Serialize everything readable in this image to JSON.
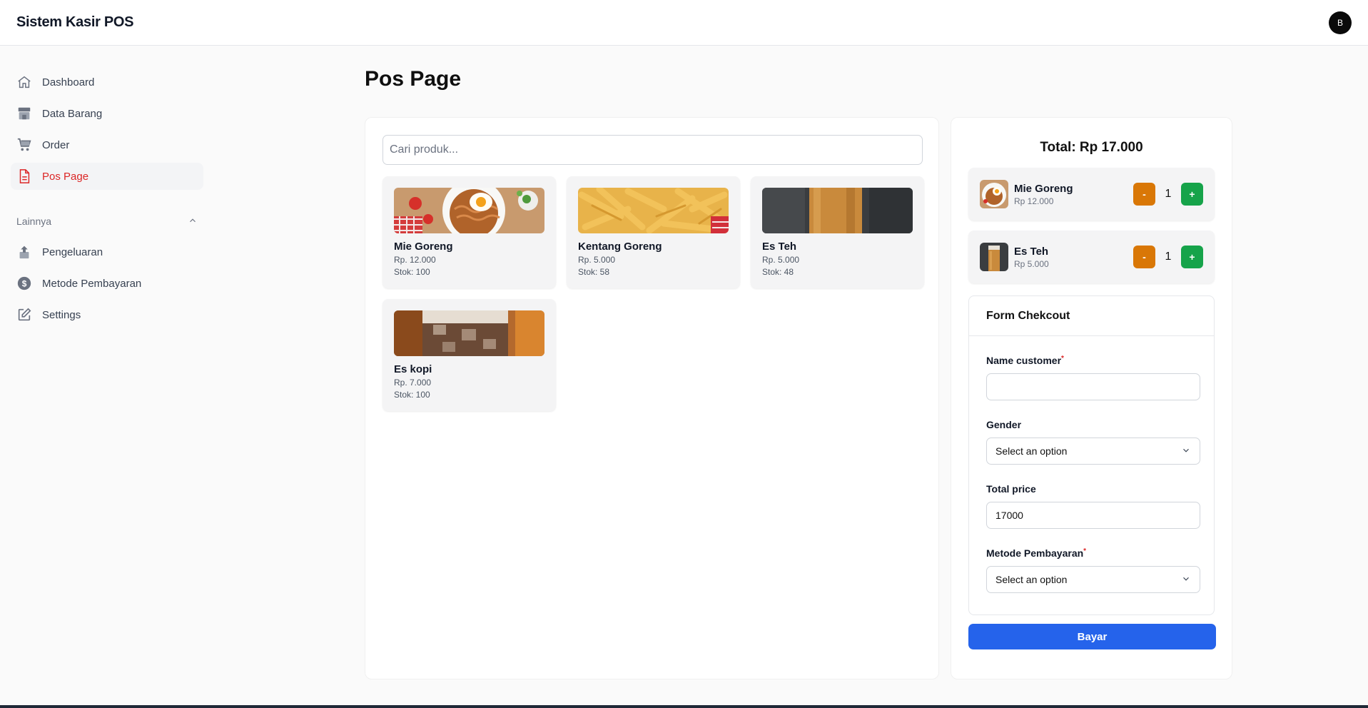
{
  "app": {
    "title": "Sistem Kasir POS",
    "user_initial": "B"
  },
  "sidebar": {
    "items": [
      {
        "label": "Dashboard",
        "icon": "home-icon"
      },
      {
        "label": "Data Barang",
        "icon": "store-icon"
      },
      {
        "label": "Order",
        "icon": "cart-icon"
      },
      {
        "label": "Pos Page",
        "icon": "document-icon"
      }
    ],
    "group_label": "Lainnya",
    "group_items": [
      {
        "label": "Pengeluaran",
        "icon": "upload-icon"
      },
      {
        "label": "Metode Pembayaran",
        "icon": "dollar-icon"
      },
      {
        "label": "Settings",
        "icon": "edit-icon"
      }
    ]
  },
  "main": {
    "title": "Pos Page",
    "search_placeholder": "Cari produk...",
    "products": [
      {
        "name": "Mie Goreng",
        "price": "Rp. 12.000",
        "stock": "Stok: 100"
      },
      {
        "name": "Kentang Goreng",
        "price": "Rp. 5.000",
        "stock": "Stok: 58"
      },
      {
        "name": "Es Teh",
        "price": "Rp. 5.000",
        "stock": "Stok: 48"
      },
      {
        "name": "Es kopi",
        "price": "Rp. 7.000",
        "stock": "Stok: 100"
      }
    ]
  },
  "cart": {
    "total": "Total: Rp 17.000",
    "items": [
      {
        "name": "Mie Goreng",
        "price": "Rp 12.000",
        "qty": "1",
        "minus": "-",
        "plus": "+"
      },
      {
        "name": "Es Teh",
        "price": "Rp 5.000",
        "qty": "1",
        "minus": "-",
        "plus": "+"
      }
    ],
    "form": {
      "title": "Form Chekcout",
      "name_label": "Name customer",
      "required_mark": "*",
      "gender_label": "Gender",
      "gender_value": "Select an option",
      "total_label": "Total price",
      "total_value": "17000",
      "method_label": "Metode Pembayaran",
      "method_value": "Select an option"
    },
    "pay_label": "Bayar"
  },
  "colors": {
    "accent_active": "#dc2626",
    "minus_button": "#d97706",
    "plus_button": "#16a34a",
    "pay_button": "#2563eb"
  }
}
